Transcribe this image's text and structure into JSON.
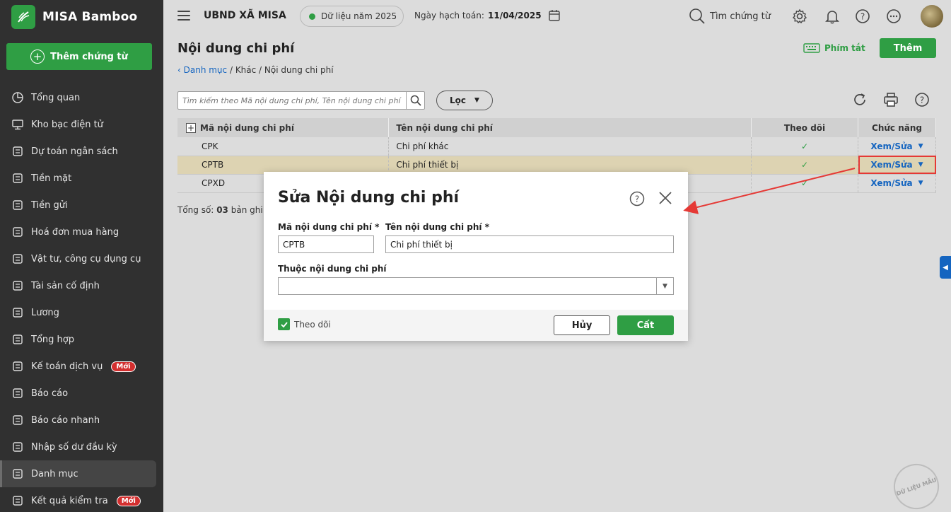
{
  "app": {
    "name": "MISA Bamboo",
    "add_voucher": "Thêm chứng từ"
  },
  "sidebar": {
    "items": [
      {
        "label": "Tổng quan",
        "icon": "pie-chart-icon"
      },
      {
        "label": "Kho bạc điện tử",
        "icon": "monitor-icon"
      },
      {
        "label": "Dự toán ngân sách",
        "icon": "budget-icon"
      },
      {
        "label": "Tiền mặt",
        "icon": "cash-icon"
      },
      {
        "label": "Tiền gửi",
        "icon": "deposit-icon"
      },
      {
        "label": "Hoá đơn mua hàng",
        "icon": "invoice-icon"
      },
      {
        "label": "Vật tư, công cụ dụng cụ",
        "icon": "tools-icon"
      },
      {
        "label": "Tài sản cố định",
        "icon": "asset-icon"
      },
      {
        "label": "Lương",
        "icon": "salary-icon"
      },
      {
        "label": "Tổng hợp",
        "icon": "summary-icon"
      },
      {
        "label": "Kế toán dịch vụ",
        "icon": "service-icon",
        "badge": "Mới"
      },
      {
        "label": "Báo cáo",
        "icon": "report-icon"
      },
      {
        "label": "Báo cáo nhanh",
        "icon": "quick-report-icon"
      },
      {
        "label": "Nhập số dư đầu kỳ",
        "icon": "opening-balance-icon"
      },
      {
        "label": "Danh mục",
        "icon": "catalog-icon",
        "active": true
      },
      {
        "label": "Kết quả kiểm tra",
        "icon": "check-result-icon",
        "badge": "Mới"
      }
    ]
  },
  "header": {
    "org": "UBND XÃ MISA",
    "data_year": "Dữ liệu năm 2025",
    "accounting_date_label": "Ngày hạch toán:",
    "accounting_date": "11/04/2025",
    "search": "Tìm chứng từ"
  },
  "page": {
    "title": "Nội dung chi phí",
    "breadcrumb": {
      "back": "Danh mục",
      "rest": " / Khác / Nội dung chi phí"
    },
    "shortcut": "Phím tắt",
    "add": "Thêm",
    "search_placeholder": "Tìm kiếm theo Mã nội dung chi phí, Tên nội dung chi phí",
    "filter": "Lọc"
  },
  "table": {
    "columns": [
      "Mã nội dung chi phí",
      "Tên nội dung chi phí",
      "Theo dõi",
      "Chức năng"
    ],
    "rows": [
      {
        "code": "CPK",
        "name": "Chi phí khác",
        "track": "✓",
        "action": "Xem/Sửa"
      },
      {
        "code": "CPTB",
        "name": "Chi phí thiết bị",
        "track": "✓",
        "action": "Xem/Sửa"
      },
      {
        "code": "CPXD",
        "name": "",
        "track": "✓",
        "action": "Xem/Sửa"
      }
    ],
    "total_label": "Tổng số:",
    "total_value": "03",
    "total_suffix": "bản ghi"
  },
  "modal": {
    "title": "Sửa Nội dung chi phí",
    "code_label": "Mã nội dung chi phí *",
    "code_value": "CPTB",
    "name_label": "Tên nội dung chi phí *",
    "name_value": "Chi phí thiết bị",
    "parent_label": "Thuộc nội dung chi phí",
    "parent_value": "",
    "track_label": "Theo dõi",
    "cancel": "Hủy",
    "save": "Cất"
  },
  "watermark": "DỮ LIỆU MẪU",
  "colors": {
    "brand_green": "#2f9e44",
    "link_blue": "#1565c0",
    "highlight_red": "#e53935",
    "sidebar": "#303030"
  }
}
